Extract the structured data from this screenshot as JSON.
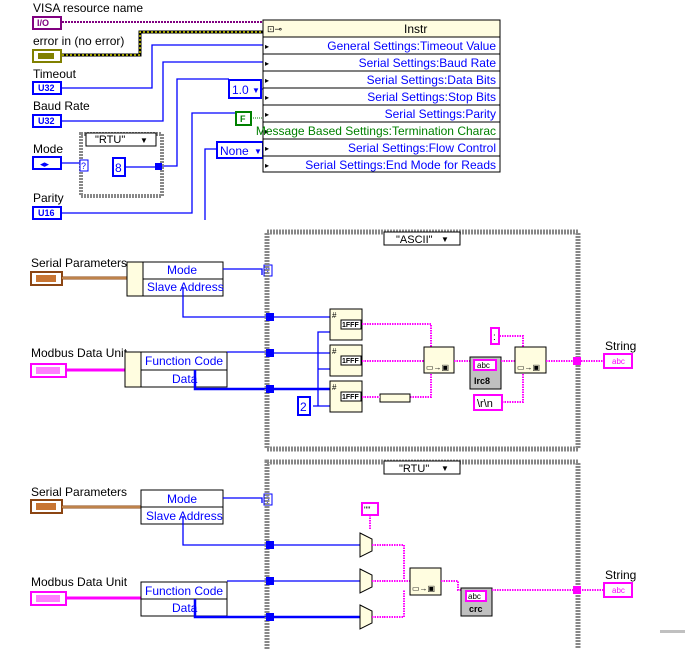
{
  "colors": {
    "integer_wire": "#0000ff",
    "string_wire": "#ff00ff",
    "refnum": "#7f007f",
    "error": "#808000",
    "boolean": "#008000",
    "cluster": "#8b4513",
    "node_bg": "#fffde0"
  },
  "controls": {
    "visa": {
      "label": "VISA resource name",
      "terminal": "I/O"
    },
    "error": {
      "label": "error in (no error)",
      "terminal": "err"
    },
    "timeout": {
      "label": "Timeout",
      "terminal": "U32"
    },
    "baud": {
      "label": "Baud Rate",
      "terminal": "U32"
    },
    "mode": {
      "label": "Mode",
      "terminal": "enum"
    },
    "parity": {
      "label": "Parity",
      "terminal": "U16"
    }
  },
  "mode_case": {
    "selector": "\"RTU\"",
    "constant": "8",
    "selector_terminal": "?"
  },
  "constants": {
    "stop_bits": "1.0",
    "termination": "F",
    "flow_control": "None"
  },
  "property_node": {
    "header": "Instr",
    "rows": [
      "General Settings:Timeout Value",
      "Serial Settings:Baud Rate",
      "Serial Settings:Data Bits",
      "Serial Settings:Stop Bits",
      "Serial Settings:Parity",
      "Message Based Settings:Termination Charac",
      "Serial Settings:Flow Control",
      "Serial Settings:End Mode for Reads"
    ]
  },
  "ascii_section": {
    "serial_label": "Serial Parameters",
    "serial_terminal": "SP",
    "unbundle1": [
      "Mode",
      "Slave Address"
    ],
    "mdu_label": "Modbus Data Unit",
    "mdu_terminal": "MDU",
    "unbundle2": [
      "Function Code",
      "Data"
    ],
    "case_selector": "\"ASCII\"",
    "hex_format": "1FFF",
    "width_constant": "2",
    "lrc": "lrc8",
    "abc": "abc",
    "colon": ":",
    "crlf": "\\r\\n",
    "output_label": "String",
    "output_terminal": "abc"
  },
  "rtu_section": {
    "serial_label": "Serial Parameters",
    "serial_terminal": "SP",
    "unbundle1": [
      "Mode",
      "Slave Address"
    ],
    "mdu_label": "Modbus Data Unit",
    "mdu_terminal": "MDU",
    "unbundle2": [
      "Function Code",
      "Data"
    ],
    "case_selector": "\"RTU\"",
    "empty_string": "\"\"",
    "crc": "crc",
    "abc": "abc",
    "output_label": "String",
    "output_terminal": "abc"
  }
}
